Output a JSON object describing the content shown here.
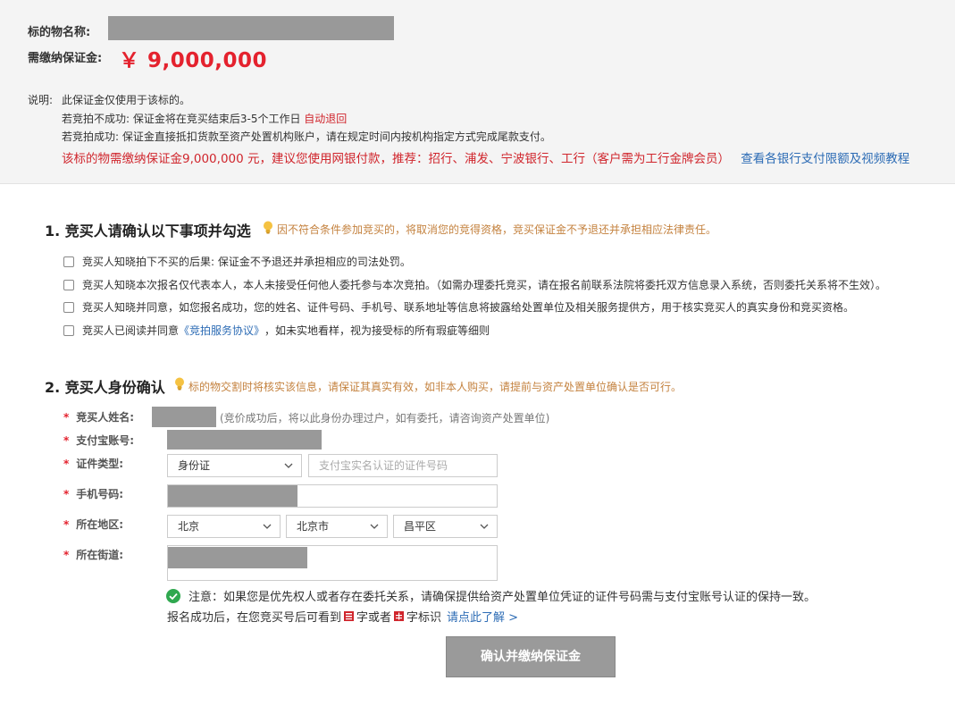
{
  "header": {
    "subject_label": "标的物名称:",
    "deposit_label": "需缴纳保证金:",
    "deposit_amount": "￥ 9,000,000"
  },
  "notes": {
    "prefix": "说明:",
    "line1": "此保证金仅使用于该标的。",
    "line2_text": "若竞拍不成功:   保证金将在竞买结束后3-5个工作日 ",
    "line2_red": "自动退回",
    "line3": "若竞拍成功:  保证金直接抵扣货款至资产处置机构账户，请在规定时间内按机构指定方式完成尾款支付。",
    "pay_advice": "该标的物需缴纳保证金9,000,000 元，建议您使用网银付款，推荐：招行、浦发、宁波银行、工行（客户需为工行金牌会员）",
    "bank_link": "查看各银行支付限额及视频教程"
  },
  "section1": {
    "title": "1. 竞买人请确认以下事项并勾选",
    "hint": "因不符合条件参加竞买的，将取消您的竞得资格，竞买保证金不予退还并承担相应法律责任。",
    "items": [
      "竞买人知晓拍下不买的后果: 保证金不予退还并承担相应的司法处罚。",
      "竞买人知晓本次报名仅代表本人，本人未接受任何他人委托参与本次竞拍。（如需办理委托竞买，请在报名前联系法院将委托双方信息录入系统，否则委托关系将不生效）。",
      "竞买人知晓并同意，如您报名成功，您的姓名、证件号码、手机号、联系地址等信息将披露给处置单位及相关服务提供方，用于核实竞买人的真实身份和竞买资格。"
    ],
    "item4_prefix": "竞买人已阅读并同意 ",
    "item4_link": "《竞拍服务协议》",
    "item4_suffix": " ，如未实地看样，视为接受标的所有瑕疵等细则"
  },
  "section2": {
    "title": "2. 竞买人身份确认",
    "hint": "标的物交割时将核实该信息，请保证其真实有效，如非本人购买，请提前与资产处置单位确认是否可行。",
    "required_mark": "*",
    "name_label": "竞买人姓名:",
    "name_hint": "(竞价成功后，将以此身份办理过户，如有委托，请咨询资产处置单位)",
    "alipay_label": "支付宝账号:",
    "id_type_label": "证件类型:",
    "id_type_value": "身份证",
    "id_number_placeholder": "支付宝实名认证的证件号码",
    "phone_label": "手机号码:",
    "region_label": "所在地区:",
    "province": "北京",
    "city": "北京市",
    "district": "昌平区",
    "street_label": "所在街道:"
  },
  "notice": {
    "text": "注意：如果您是优先权人或者存在委托关系，请确保提供给资产处置单位凭证的证件号码需与支付宝账号认证的保持一致。",
    "after_prefix": "报名成功后，在您竞买号后可看到",
    "after_mid": "字或者",
    "after_suffix": "字标识",
    "learn_more": "请点此了解 >"
  },
  "submit": {
    "label": "确认并缴纳保证金"
  },
  "colors": {
    "accent_red": "#e4222e",
    "link_blue": "#2d6cb5",
    "hint_orange": "#c4823f",
    "button_gray": "#9a9a9a",
    "ok_green": "#2fa84f"
  }
}
